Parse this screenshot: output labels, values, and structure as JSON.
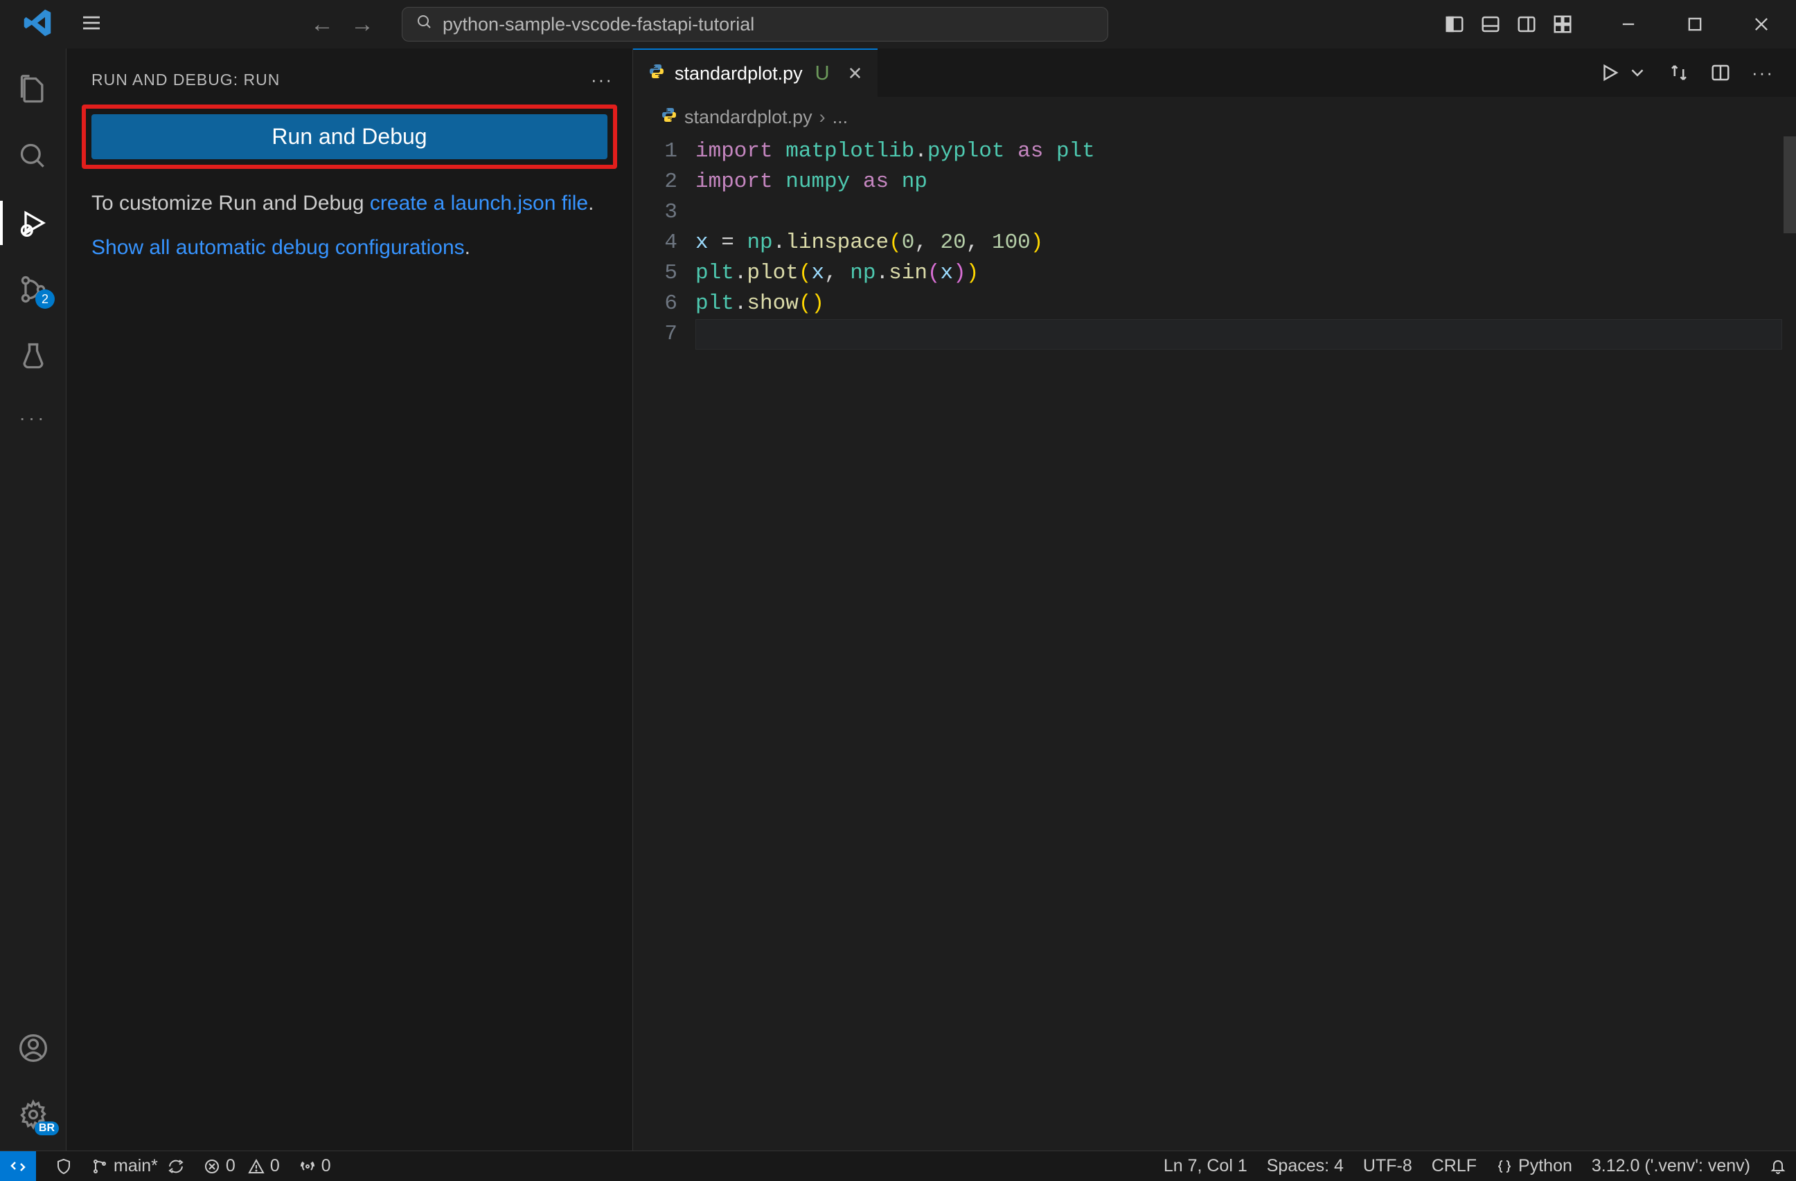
{
  "titlebar": {
    "search_text": "python-sample-vscode-fastapi-tutorial"
  },
  "activity": {
    "scm_badge": "2",
    "settings_badge": "BR"
  },
  "sidebar": {
    "header": "RUN AND DEBUG: RUN",
    "run_button": "Run and Debug",
    "customize_text": "To customize Run and Debug ",
    "create_launch_link": "create a launch.json file",
    "period": ".",
    "show_auto_link": "Show all automatic debug configurations",
    "period2": "."
  },
  "editor": {
    "tab_filename": "standardplot.py",
    "tab_modified": "U",
    "breadcrumb_file": "standardplot.py",
    "breadcrumb_more": "...",
    "line_numbers": [
      "1",
      "2",
      "3",
      "4",
      "5",
      "6",
      "7"
    ],
    "code": {
      "l1": {
        "kw": "import",
        "sp": " ",
        "mod": "matplotlib",
        "dot": ".",
        "sub": "pyplot",
        "sp2": " ",
        "as": "as",
        "sp3": " ",
        "alias": "plt"
      },
      "l2": {
        "kw": "import",
        "sp": " ",
        "mod": "numpy",
        "sp2": " ",
        "as": "as",
        "sp3": " ",
        "alias": "np"
      },
      "l4": {
        "var": "x",
        "sp": " ",
        "eq": "=",
        "sp2": " ",
        "obj": "np",
        "dot": ".",
        "fn": "linspace",
        "lp": "(",
        "n1": "0",
        "c1": ",",
        "sp3": " ",
        "n2": "20",
        "c2": ",",
        "sp4": " ",
        "n3": "100",
        "rp": ")"
      },
      "l5": {
        "obj": "plt",
        "dot": ".",
        "fn": "plot",
        "lp": "(",
        "var": "x",
        "c1": ",",
        "sp": " ",
        "obj2": "np",
        "dot2": ".",
        "fn2": "sin",
        "lp2": "(",
        "var2": "x",
        "rp2": ")",
        "rp": ")"
      },
      "l6": {
        "obj": "plt",
        "dot": ".",
        "fn": "show",
        "lp": "(",
        "rp": ")"
      }
    }
  },
  "status": {
    "branch": "main*",
    "errors": "0",
    "warnings": "0",
    "ports": "0",
    "cursor": "Ln 7, Col 1",
    "spaces": "Spaces: 4",
    "encoding": "UTF-8",
    "eol": "CRLF",
    "lang": "Python",
    "interpreter": "3.12.0 ('.venv': venv)"
  }
}
